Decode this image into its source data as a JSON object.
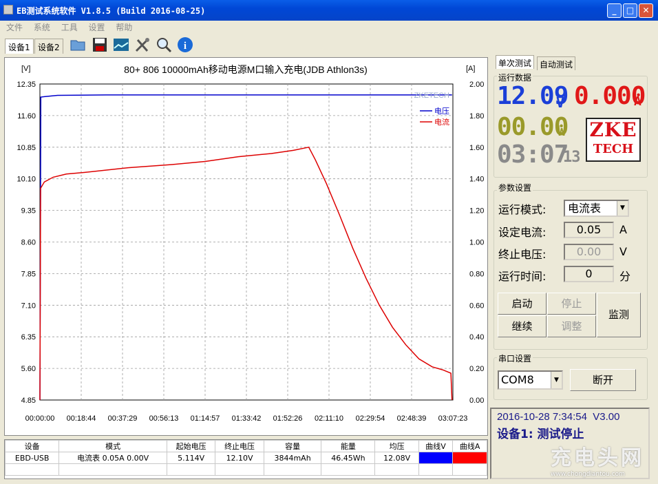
{
  "window": {
    "title": "EB测试系统软件 V1.8.5 (Build 2016-08-25)"
  },
  "menu": [
    "文件",
    "系统",
    "工具",
    "设置",
    "帮助"
  ],
  "device_tabs": [
    "设备1",
    "设备2"
  ],
  "chart_data": {
    "type": "line",
    "title": "80+ 806 10000mAh移动电源M口输入充电(JDB Athlon3s)",
    "ylabel_left": "[V]",
    "ylabel_right": "[A]",
    "y_left_ticks": [
      "12.35",
      "11.60",
      "10.85",
      "10.10",
      "9.35",
      "8.60",
      "7.85",
      "7.10",
      "6.35",
      "5.60",
      "4.85"
    ],
    "y_right_ticks": [
      "2.00",
      "1.80",
      "1.60",
      "1.40",
      "1.20",
      "1.00",
      "0.80",
      "0.60",
      "0.40",
      "0.20",
      "0.00"
    ],
    "x_ticks": [
      "00:00:00",
      "00:18:44",
      "00:37:29",
      "00:56:13",
      "01:14:57",
      "01:33:42",
      "01:52:26",
      "02:11:10",
      "02:29:54",
      "02:48:39",
      "03:07:23"
    ],
    "ylim_left": [
      4.85,
      12.35
    ],
    "ylim_right": [
      0,
      2.0
    ],
    "xlim_minutes": [
      0,
      187.4
    ],
    "grid": true,
    "legend_position": "top-right",
    "watermark_text": "ZKETECH",
    "series": [
      {
        "name": "电压",
        "color": "#0000cc",
        "axis": "left",
        "points": [
          [
            0,
            4.85
          ],
          [
            0.4,
            12.04
          ],
          [
            2,
            12.05
          ],
          [
            8,
            12.08
          ],
          [
            30,
            12.09
          ],
          [
            187.0,
            12.09
          ]
        ]
      },
      {
        "name": "电流",
        "color": "#dd0000",
        "axis": "right",
        "points": [
          [
            0,
            0
          ],
          [
            0.3,
            1.34
          ],
          [
            2,
            1.38
          ],
          [
            6,
            1.41
          ],
          [
            12,
            1.43
          ],
          [
            20,
            1.44
          ],
          [
            40,
            1.47
          ],
          [
            60,
            1.49
          ],
          [
            75,
            1.51
          ],
          [
            90,
            1.54
          ],
          [
            105,
            1.56
          ],
          [
            115,
            1.58
          ],
          [
            122,
            1.6
          ],
          [
            125,
            1.52
          ],
          [
            130,
            1.37
          ],
          [
            136,
            1.17
          ],
          [
            142,
            0.96
          ],
          [
            148,
            0.77
          ],
          [
            154,
            0.6
          ],
          [
            160,
            0.46
          ],
          [
            166,
            0.35
          ],
          [
            172,
            0.26
          ],
          [
            178,
            0.21
          ],
          [
            183,
            0.19
          ],
          [
            186.5,
            0.17
          ],
          [
            187,
            0.0
          ]
        ]
      }
    ]
  },
  "right_tabs": [
    "单次测试",
    "自动测试"
  ],
  "run_data": {
    "label": "运行数据",
    "voltage": "12.09",
    "voltage_unit": "V",
    "current": "0.000",
    "current_unit": "A",
    "power": "00.00",
    "power_unit": "W",
    "time": "03:07",
    "time_seconds": "13",
    "logo_line1": "ZKE",
    "logo_line2": "TECH",
    "voltage_color": "#1b3fd8",
    "current_color": "#e01818",
    "power_color": "#9a9a2a"
  },
  "params": {
    "label": "参数设置",
    "mode_label": "运行模式:",
    "mode_value": "电流表",
    "current_label": "设定电流:",
    "current_value": "0.05",
    "current_unit": "A",
    "end_voltage_label": "终止电压:",
    "end_voltage_value": "0.00",
    "end_voltage_unit": "V",
    "run_time_label": "运行时间:",
    "run_time_value": "0",
    "run_time_unit": "分"
  },
  "buttons": {
    "start": "启动",
    "stop": "停止",
    "continue": "继续",
    "adjust": "调整",
    "monitor": "监测"
  },
  "serial": {
    "label": "串口设置",
    "port": "COM8",
    "disconnect": "断开"
  },
  "status": {
    "line1": "2016-10-28 7:34:54  V3.00",
    "line2": "设备1: 测试停止"
  },
  "table": {
    "headers": [
      "设备",
      "模式",
      "起始电压",
      "终止电压",
      "容量",
      "能量",
      "均压",
      "曲线V",
      "曲线A"
    ],
    "row": [
      "EBD-USB",
      "电流表  0.05A  0.00V",
      "5.114V",
      "12.10V",
      "3844mAh",
      "46.45Wh",
      "12.08V",
      "",
      ""
    ],
    "curve_v_color": "#0000ff",
    "curve_a_color": "#ff0000"
  },
  "watermark": {
    "text": "充电头网",
    "url": "www.chongdiantou.com"
  }
}
